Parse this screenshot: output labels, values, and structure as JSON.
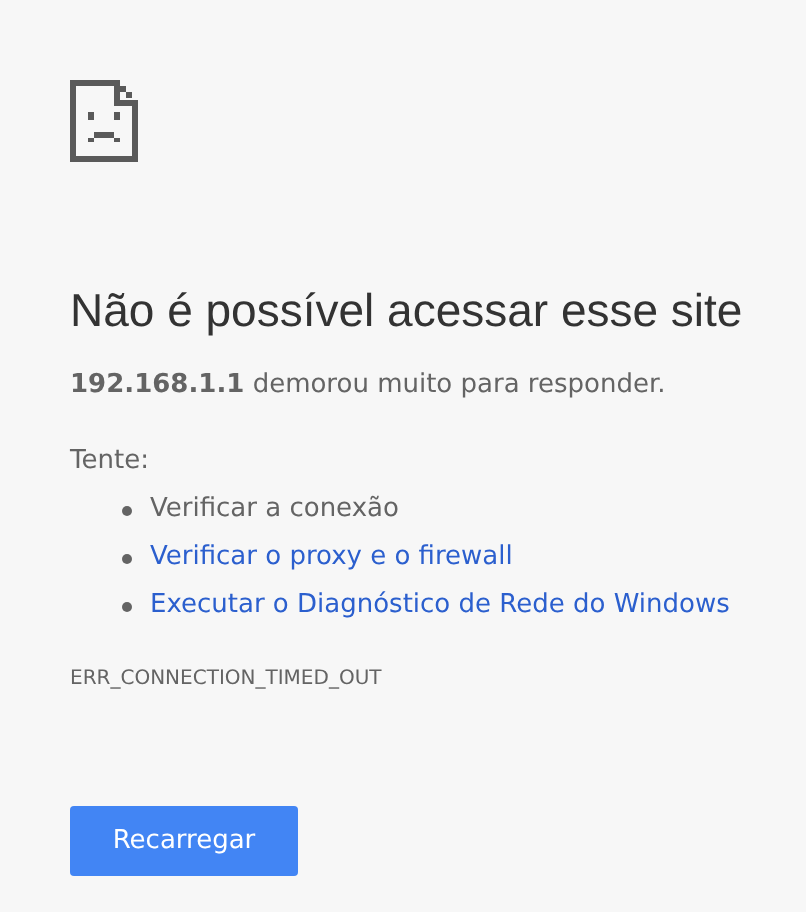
{
  "heading": "Não é possível acessar esse site",
  "summary": "**192.168.1.1** demorou muito para responder.",
  "suggestions": {
    "label": "Tente:",
    "items": [
      {
        "kind": "text",
        "label": "Verificar a conexão"
      },
      {
        "kind": "link",
        "label": "Verificar o proxy e o firewall"
      },
      {
        "kind": "link",
        "label": "Executar o Diagnóstico de Rede do Windows"
      }
    ]
  },
  "error_code": "ERR_CONNECTION_TIMED_OUT",
  "reload_button": "Recarregar"
}
